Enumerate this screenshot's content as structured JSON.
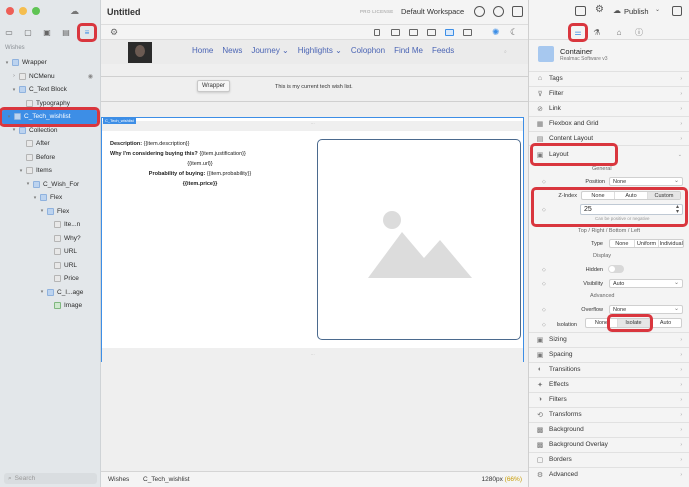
{
  "window": {
    "doc_title": "Untitled",
    "license": "PRO LICENSE",
    "workspace": "Default Workspace",
    "publish_label": "Publish"
  },
  "sidebar": {
    "section_label": "Wishes",
    "search_placeholder": "Search",
    "tree": [
      {
        "label": "Wrapper",
        "depth": 0,
        "kind": "container",
        "chev": "▾"
      },
      {
        "label": "NCMenu",
        "depth": 1,
        "kind": "gray",
        "chev": "›"
      },
      {
        "label": "C_Text Block",
        "depth": 1,
        "kind": "container",
        "chev": "▾"
      },
      {
        "label": "Typography",
        "depth": 2,
        "kind": "gray",
        "chev": ""
      },
      {
        "label": "C_Tech_wishlist",
        "depth": 0,
        "kind": "container",
        "chev": "▾",
        "selected": true
      },
      {
        "label": "Collection",
        "depth": 1,
        "kind": "container",
        "chev": "▾"
      },
      {
        "label": "After",
        "depth": 2,
        "kind": "gray",
        "chev": ""
      },
      {
        "label": "Before",
        "depth": 2,
        "kind": "gray",
        "chev": ""
      },
      {
        "label": "Items",
        "depth": 2,
        "kind": "gray",
        "chev": "▾"
      },
      {
        "label": "C_Wish_For",
        "depth": 3,
        "kind": "container",
        "chev": "▾"
      },
      {
        "label": "Flex",
        "depth": 4,
        "kind": "container",
        "chev": "▾"
      },
      {
        "label": "Flex",
        "depth": 5,
        "kind": "container",
        "chev": "▾"
      },
      {
        "label": "Ite...n",
        "depth": 6,
        "kind": "gray",
        "chev": ""
      },
      {
        "label": "Why?",
        "depth": 6,
        "kind": "gray",
        "chev": ""
      },
      {
        "label": "URL",
        "depth": 6,
        "kind": "gray",
        "chev": ""
      },
      {
        "label": "URL",
        "depth": 6,
        "kind": "gray",
        "chev": ""
      },
      {
        "label": "Price",
        "depth": 6,
        "kind": "gray",
        "chev": ""
      },
      {
        "label": "C_I...age",
        "depth": 5,
        "kind": "container",
        "chev": "▾"
      },
      {
        "label": "Image",
        "depth": 6,
        "kind": "img",
        "chev": ""
      }
    ]
  },
  "site": {
    "menu": [
      "Home",
      "News",
      "Journey ⌄",
      "Highlights ⌄",
      "Colophon",
      "Find Me",
      "Feeds"
    ],
    "wrapper_tooltip": "Wrapper",
    "wishlist_text": "This is my current tech wish list.",
    "tech_label": "C_Tech_wishlist",
    "gap_marker": "⋯",
    "desc_label": "Description:",
    "desc_value": " {{item.description}}",
    "why_label": "Why I'm considering buying this?",
    "why_value": " {{item.justification}}",
    "url_value": "{{item.url}}",
    "prob_label": "Probability of buying:",
    "prob_value": " {{item.probability}}",
    "price_value": "{{item.price}}"
  },
  "status": {
    "collection": "Wishes",
    "path": "C_Tech_wishlist",
    "zoom_px": "1280px",
    "zoom_pct": "(66%)"
  },
  "inspector": {
    "component_name": "Container",
    "component_vendor": "Realmac Software",
    "component_version": "v3",
    "sections_top": [
      "Tags",
      "Filter",
      "Link",
      "Flexbox and Grid",
      "Content Layout"
    ],
    "layout_title": "Layout",
    "general_label": "General",
    "position_label": "Position",
    "position_value": "None",
    "zindex_label": "Z-Index",
    "zindex_options": [
      "None",
      "Auto",
      "Custom"
    ],
    "zindex_value": "25",
    "zindex_hint": "Can be positive or negative",
    "trbl_label": "Top / Right / Bottom / Left",
    "type_label": "Type",
    "type_options": [
      "None",
      "Uniform",
      "Individual"
    ],
    "display_label": "Display",
    "hidden_label": "Hidden",
    "visibility_label": "Visibility",
    "visibility_value": "Auto",
    "advanced_label": "Advanced",
    "overflow_label": "Overflow",
    "overflow_value": "None",
    "isolation_label": "Isolation",
    "isolation_options": [
      "None",
      "Isolate",
      "Auto"
    ],
    "sections_bottom": [
      "Sizing",
      "Spacing",
      "Transitions",
      "Effects",
      "Filters",
      "Transforms",
      "Background",
      "Background Overlay",
      "Borders",
      "Advanced"
    ]
  },
  "colors": {
    "accent": "#3d8ee6",
    "highlight": "#d9363e"
  }
}
